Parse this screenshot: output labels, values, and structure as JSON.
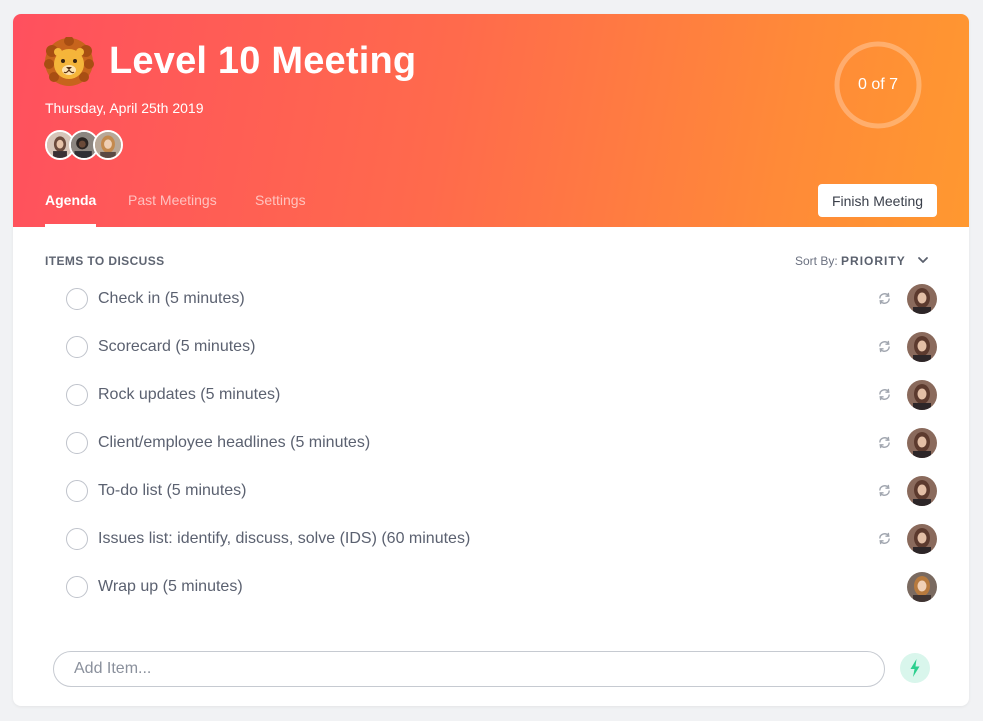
{
  "meeting": {
    "emoji_icon": "lion-face-icon",
    "title": "Level 10 Meeting",
    "date": "Thursday, April 25th 2019",
    "progress_label": "0 of 7",
    "progress_fraction": 0
  },
  "tabs": [
    {
      "label": "Agenda",
      "active": true
    },
    {
      "label": "Past Meetings",
      "active": false
    },
    {
      "label": "Settings",
      "active": false
    }
  ],
  "finish_label": "Finish Meeting",
  "section": {
    "heading": "ITEMS TO DISCUSS",
    "sort_prefix": "Sort By:",
    "sort_value": "PRIORITY"
  },
  "items": [
    {
      "label": "Check in (5 minutes)",
      "recurring": true
    },
    {
      "label": "Scorecard (5 minutes)",
      "recurring": true
    },
    {
      "label": "Rock updates (5 minutes)",
      "recurring": true
    },
    {
      "label": "Client/employee headlines (5 minutes)",
      "recurring": true
    },
    {
      "label": "To-do list (5 minutes)",
      "recurring": true
    },
    {
      "label": "Issues list: identify, discuss, solve (IDS) (60 minutes)",
      "recurring": true
    },
    {
      "label": "Wrap up (5 minutes)",
      "recurring": false
    }
  ],
  "add_item": {
    "placeholder": "Add Item..."
  },
  "colors": {
    "gradient_start": "#ff505e",
    "gradient_end": "#ff9830",
    "bolt_accent": "#2ccf8e"
  }
}
